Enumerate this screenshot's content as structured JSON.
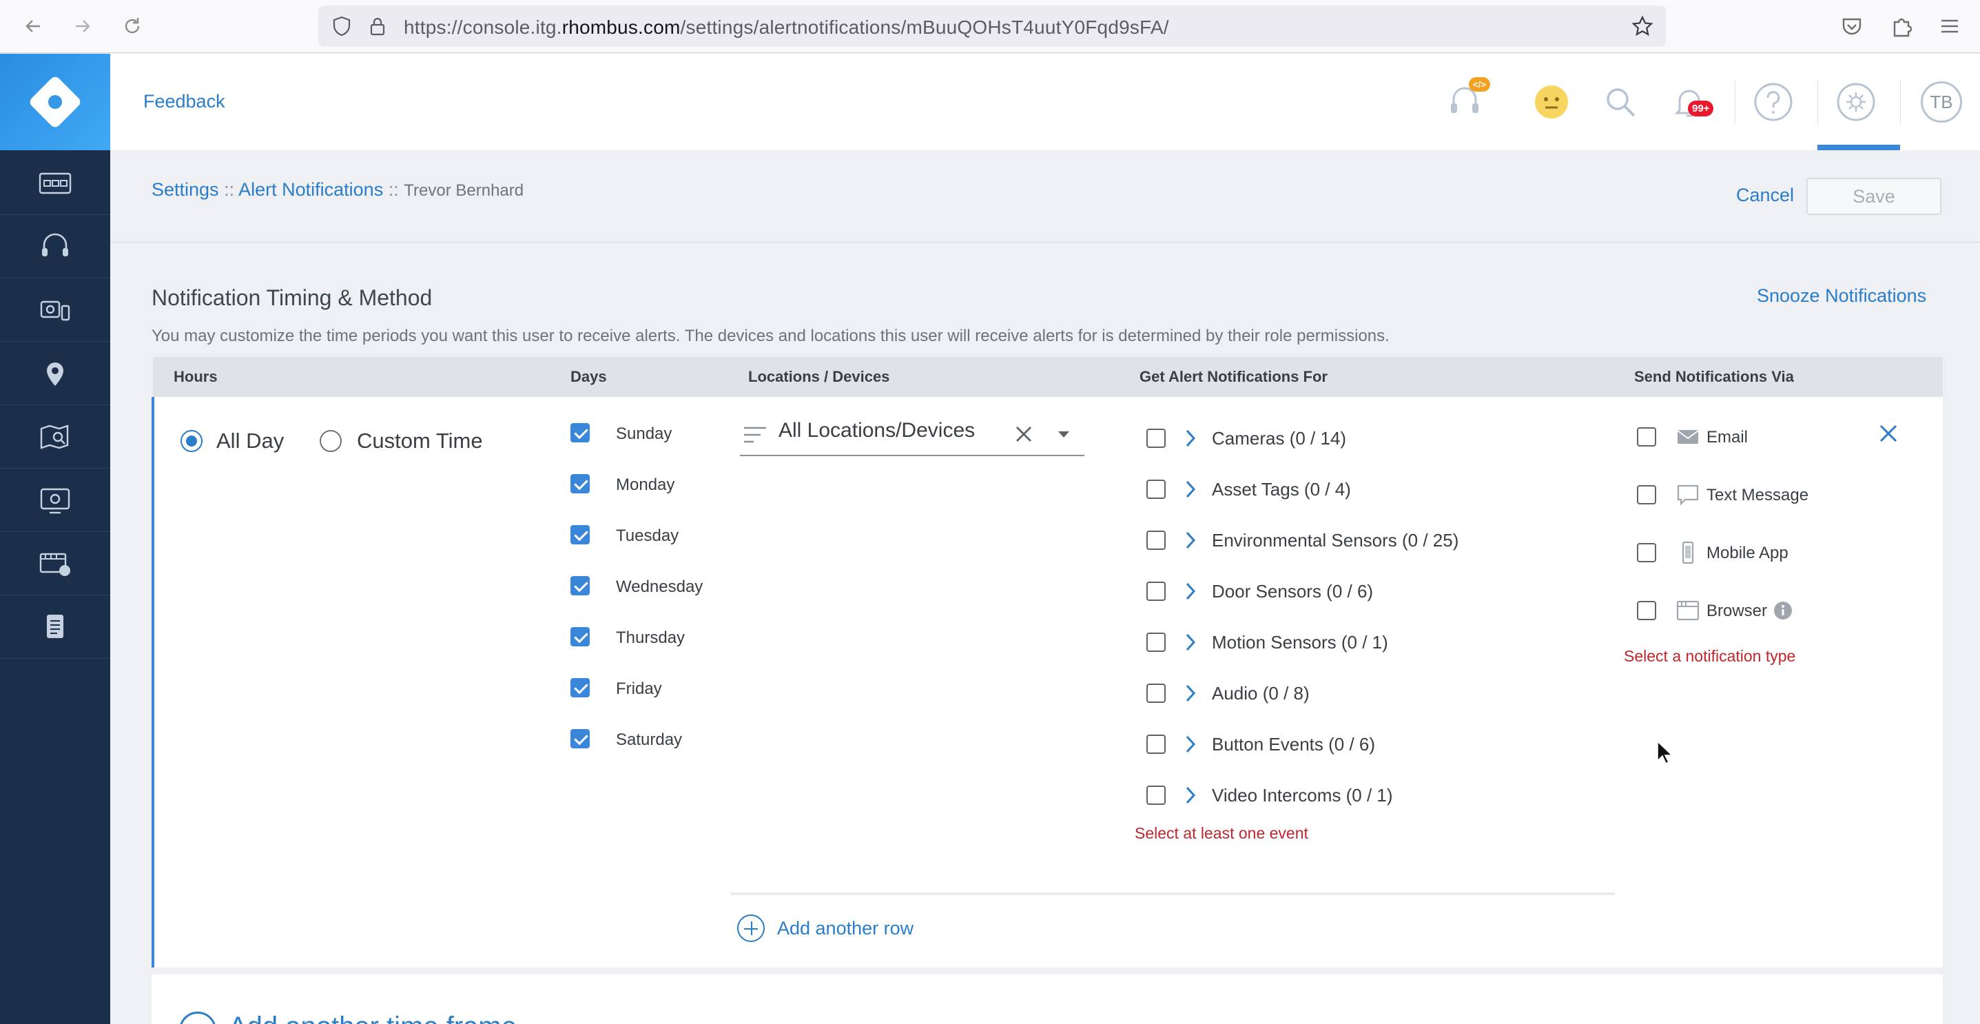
{
  "browser": {
    "url_prefix": "https://console.itg.",
    "url_domain": "rhombus.com",
    "url_path": "/settings/alertnotifications/mBuuQOHsT4uutY0Fqd9sFA/"
  },
  "header": {
    "feedback_label": "Feedback",
    "notification_badge": "99+",
    "dev_badge": "</>",
    "avatar_initials": "TB"
  },
  "breadcrumb": {
    "settings": "Settings",
    "sep": "::",
    "alert_notifications": "Alert Notifications",
    "user": "Trevor Bernhard"
  },
  "actions": {
    "cancel": "Cancel",
    "save": "Save"
  },
  "section": {
    "title": "Notification Timing & Method",
    "description": "You may customize the time periods you want this user to receive alerts. The devices and locations this user will receive alerts for is determined by their role permissions.",
    "snooze": "Snooze Notifications"
  },
  "table_headers": {
    "hours": "Hours",
    "days": "Days",
    "locations": "Locations / Devices",
    "events": "Get Alert Notifications For",
    "method": "Send Notifications Via"
  },
  "hours": {
    "all_day": "All Day",
    "custom_time": "Custom Time",
    "selected": "all_day"
  },
  "days": [
    {
      "label": "Sunday",
      "checked": true
    },
    {
      "label": "Monday",
      "checked": true
    },
    {
      "label": "Tuesday",
      "checked": true
    },
    {
      "label": "Wednesday",
      "checked": true
    },
    {
      "label": "Thursday",
      "checked": true
    },
    {
      "label": "Friday",
      "checked": true
    },
    {
      "label": "Saturday",
      "checked": true
    }
  ],
  "locations": {
    "value": "All Locations/Devices"
  },
  "events": [
    {
      "label": "Cameras (0 / 14)",
      "checked": false
    },
    {
      "label": "Asset Tags (0 / 4)",
      "checked": false
    },
    {
      "label": "Environmental Sensors (0 / 25)",
      "checked": false
    },
    {
      "label": "Door Sensors (0 / 6)",
      "checked": false
    },
    {
      "label": "Motion Sensors (0 / 1)",
      "checked": false
    },
    {
      "label": "Audio (0 / 8)",
      "checked": false
    },
    {
      "label": "Button Events (0 / 6)",
      "checked": false
    },
    {
      "label": "Video Intercoms (0 / 1)",
      "checked": false
    }
  ],
  "events_error": "Select at least one event",
  "methods": [
    {
      "label": "Email",
      "icon": "email-icon",
      "checked": false
    },
    {
      "label": "Text Message",
      "icon": "text-message-icon",
      "checked": false
    },
    {
      "label": "Mobile App",
      "icon": "mobile-app-icon",
      "checked": false
    },
    {
      "label": "Browser",
      "icon": "browser-icon",
      "checked": false
    }
  ],
  "methods_error": "Select a notification type",
  "add_row": "Add another row",
  "add_timeframe": "Add another time frame",
  "colors": {
    "accent": "#2a7dc9",
    "sidebar": "#1b2f4a",
    "error": "#c0262d",
    "checkbox_on": "#3a86d9"
  }
}
